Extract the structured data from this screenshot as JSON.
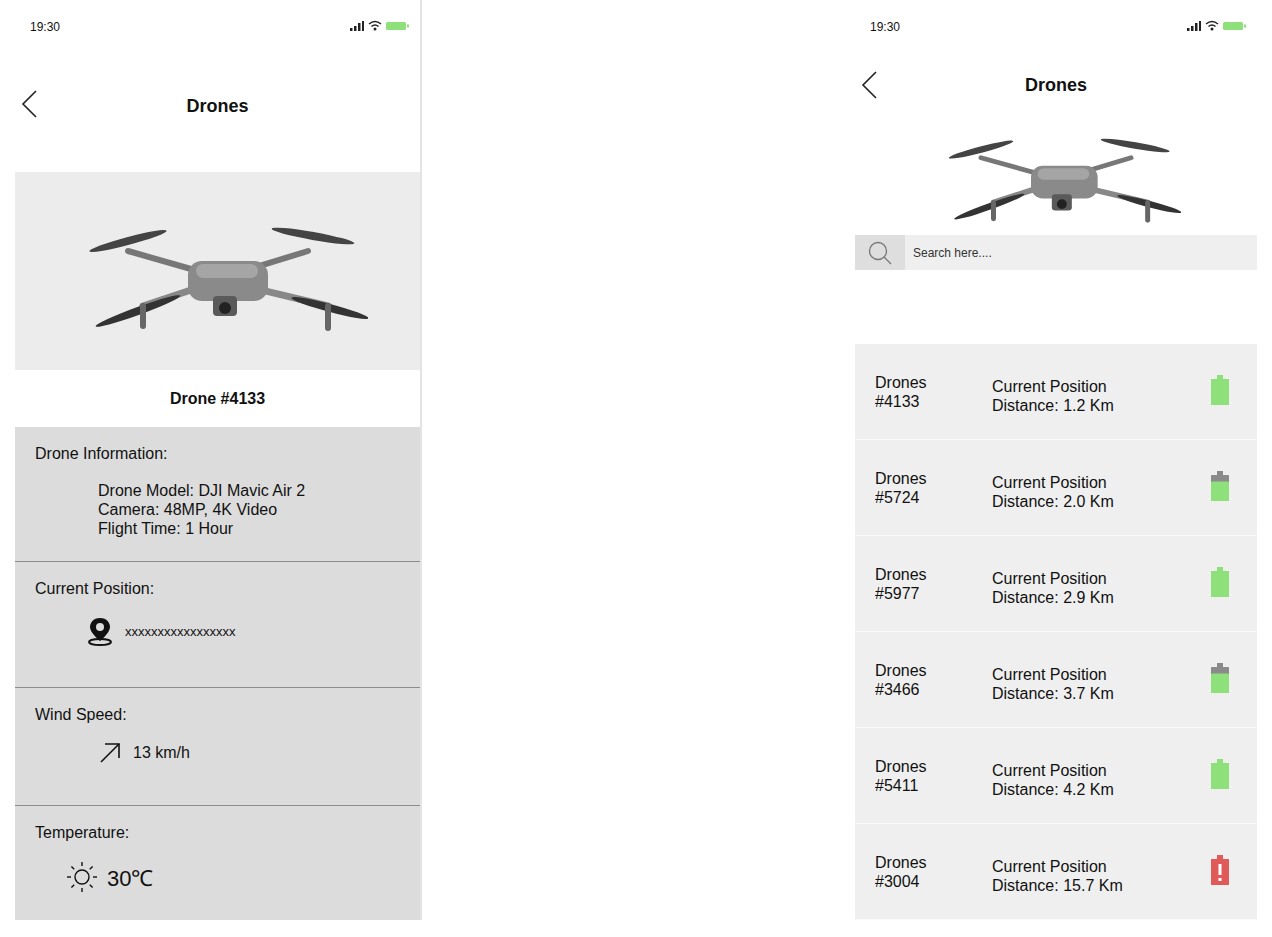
{
  "left": {
    "status_time": "19:30",
    "title": "Drones",
    "drone_name": "Drone #4133",
    "sections": [
      {
        "kind": "info",
        "heading": "Drone Information:",
        "lines": [
          "Drone Model: DJI Mavic Air 2",
          "Camera: 48MP, 4K Video",
          "Flight Time: 1 Hour"
        ]
      },
      {
        "kind": "location",
        "heading": "Current Position:",
        "value": "xxxxxxxxxxxxxxxxx"
      },
      {
        "kind": "wind",
        "heading": "Wind Speed:",
        "value": "13 km/h"
      },
      {
        "kind": "temperature",
        "heading": "Temperature:",
        "value": "30℃"
      }
    ]
  },
  "right": {
    "status_time": "19:30",
    "title": "Drones",
    "search": {
      "placeholder": "Search here...."
    },
    "drones": [
      {
        "label": "Drones",
        "number": "#4133",
        "position": "Current Position",
        "distance": "Distance: 1.2 Km",
        "battery": {
          "level": 1,
          "color": "#8ee07a",
          "alert": false
        }
      },
      {
        "label": "Drones",
        "number": "#5724",
        "position": "Current Position",
        "distance": "Distance: 2.0 Km",
        "battery": {
          "level": 0.75,
          "color": "#8ee07a",
          "alert": false
        }
      },
      {
        "label": "Drones",
        "number": "#5977",
        "position": "Current Position",
        "distance": "Distance: 2.9 Km",
        "battery": {
          "level": 1,
          "color": "#8ee07a",
          "alert": false
        }
      },
      {
        "label": "Drones",
        "number": "#3466",
        "position": "Current Position",
        "distance": "Distance: 3.7 Km",
        "battery": {
          "level": 0.75,
          "color": "#8ee07a",
          "alert": false
        }
      },
      {
        "label": "Drones",
        "number": "#5411",
        "position": "Current Position",
        "distance": "Distance: 4.2 Km",
        "battery": {
          "level": 1,
          "color": "#8ee07a",
          "alert": false
        }
      },
      {
        "label": "Drones",
        "number": "#3004",
        "position": "Current Position",
        "distance": "Distance: 15.7 Km",
        "battery": {
          "level": 1,
          "color": "#e05a5a",
          "alert": true
        }
      }
    ]
  }
}
